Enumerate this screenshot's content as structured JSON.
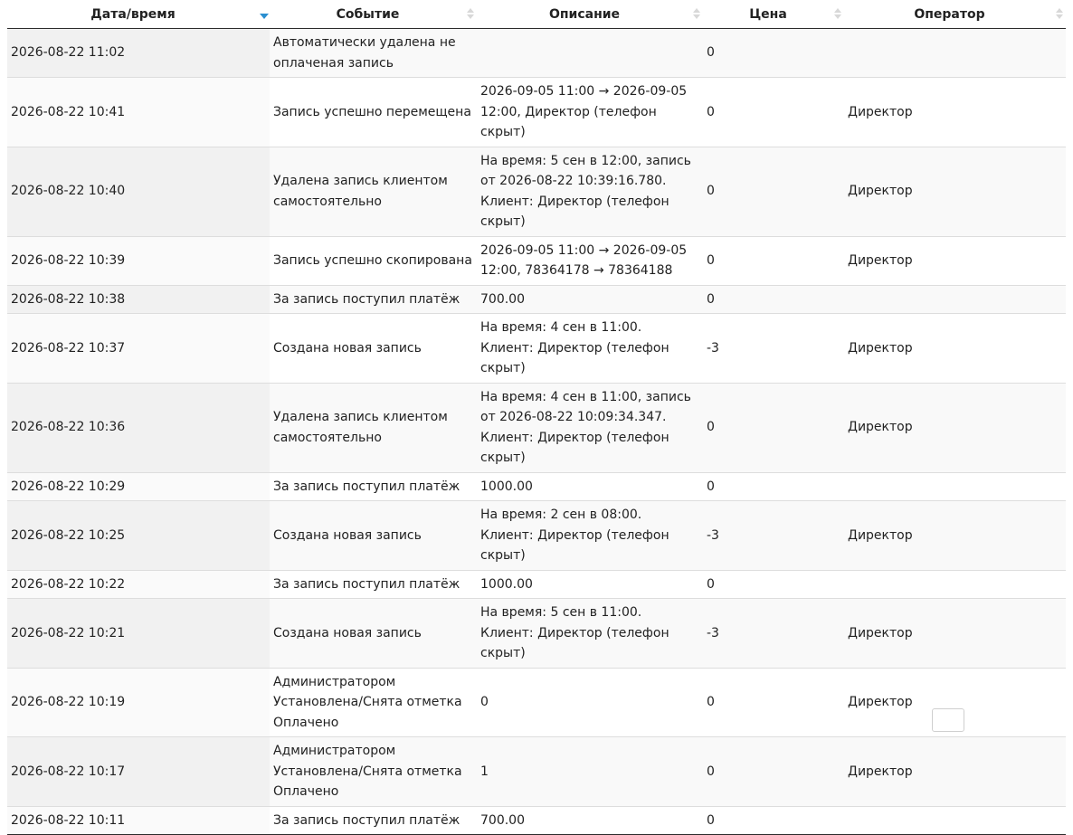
{
  "columns": [
    "Дата/время",
    "Событие",
    "Описание",
    "Цена",
    "Оператор"
  ],
  "sorted_column": "Дата/время",
  "sort_direction": "desc",
  "rows": [
    {
      "datetime": "2026-08-22 11:02",
      "event": "Автоматически удалена не оплаченая запись",
      "description": "",
      "price": "0",
      "operator": ""
    },
    {
      "datetime": "2026-08-22 10:41",
      "event": "Запись успешно перемещена",
      "description": "2026-09-05 11:00 → 2026-09-05 12:00, Директор (телефон скрыт)",
      "price": "0",
      "operator": "Директор"
    },
    {
      "datetime": "2026-08-22 10:40",
      "event": "Удалена запись клиентом самостоятельно",
      "description": "На время: 5 сен в 12:00, запись от 2026-08-22 10:39:16.780. Клиент: Директор (телефон скрыт)",
      "price": "0",
      "operator": "Директор"
    },
    {
      "datetime": "2026-08-22 10:39",
      "event": "Запись успешно скопирована",
      "description": "2026-09-05 11:00 → 2026-09-05 12:00, 78364178 → 78364188",
      "price": "0",
      "operator": "Директор"
    },
    {
      "datetime": "2026-08-22 10:38",
      "event": "За запись поступил платёж",
      "description": "700.00",
      "price": "0",
      "operator": ""
    },
    {
      "datetime": "2026-08-22 10:37",
      "event": "Создана новая запись",
      "description": "На время: 4 сен в 11:00. Клиент: Директор (телефон скрыт)",
      "price": "-3",
      "operator": "Директор"
    },
    {
      "datetime": "2026-08-22 10:36",
      "event": "Удалена запись клиентом самостоятельно",
      "description": "На время: 4 сен в 11:00, запись от 2026-08-22 10:09:34.347. Клиент: Директор (телефон скрыт)",
      "price": "0",
      "operator": "Директор"
    },
    {
      "datetime": "2026-08-22 10:29",
      "event": "За запись поступил платёж",
      "description": "1000.00",
      "price": "0",
      "operator": ""
    },
    {
      "datetime": "2026-08-22 10:25",
      "event": "Создана новая запись",
      "description": "На время: 2 сен в 08:00. Клиент: Директор (телефон скрыт)",
      "price": "-3",
      "operator": "Директор"
    },
    {
      "datetime": "2026-08-22 10:22",
      "event": "За запись поступил платёж",
      "description": "1000.00",
      "price": "0",
      "operator": ""
    },
    {
      "datetime": "2026-08-22 10:21",
      "event": "Создана новая запись",
      "description": "На время: 5 сен в 11:00. Клиент: Директор (телефон скрыт)",
      "price": "-3",
      "operator": "Директор"
    },
    {
      "datetime": "2026-08-22 10:19",
      "event": "Администратором Установлена/Снята отметка Оплачено",
      "description": "0",
      "price": "0",
      "operator": "Директор"
    },
    {
      "datetime": "2026-08-22 10:17",
      "event": "Администратором Установлена/Снята отметка Оплачено",
      "description": "1",
      "price": "0",
      "operator": "Директор"
    },
    {
      "datetime": "2026-08-22 10:11",
      "event": "За запись поступил платёж",
      "description": "700.00",
      "price": "0",
      "operator": ""
    }
  ],
  "colors": {
    "sort_active": "#2a8fd0",
    "sort_inactive": "#d8d8d8",
    "row_stripe": "#f9f9f9",
    "header_border": "#2b2b2b"
  }
}
